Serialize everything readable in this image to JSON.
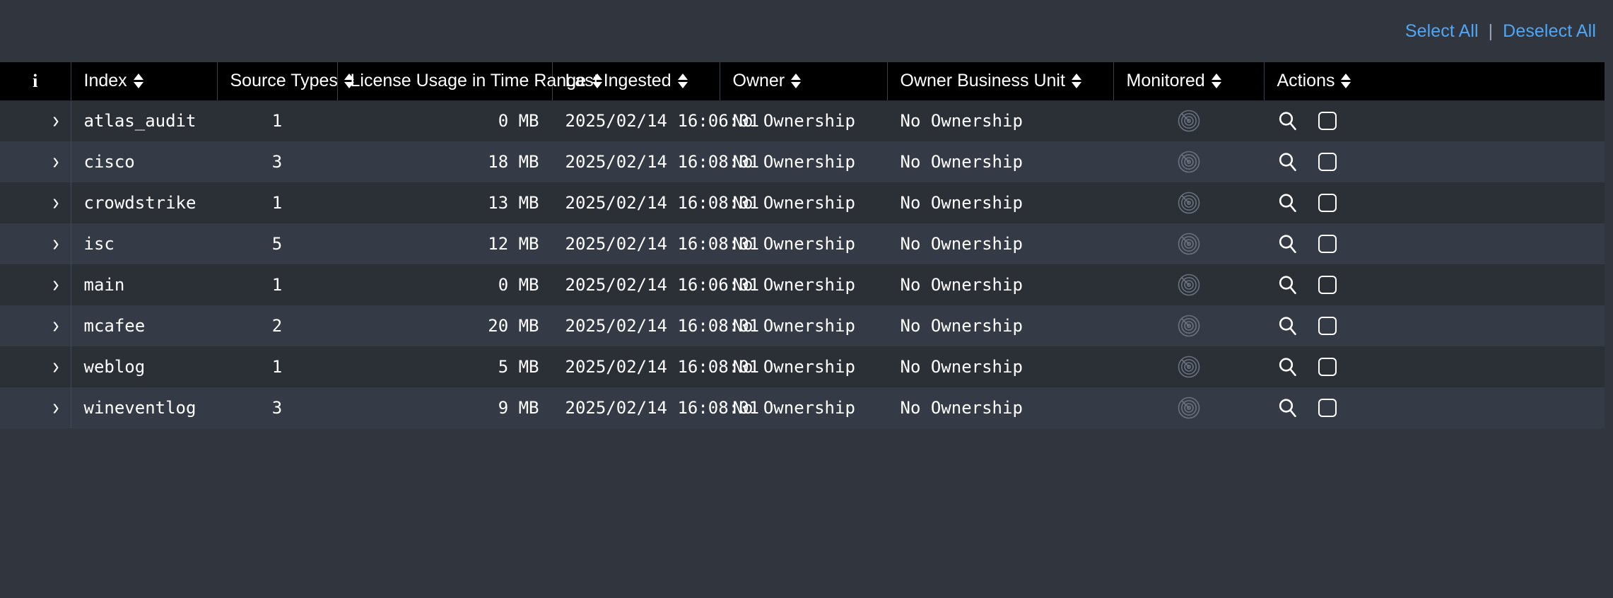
{
  "toolbar": {
    "select_all_label": "Select All",
    "separator": "|",
    "deselect_all_label": "Deselect All",
    "link_color": "#4fa6f5"
  },
  "table": {
    "info_header": "i",
    "columns": [
      {
        "key": "info",
        "label": "i",
        "sortable": false
      },
      {
        "key": "index",
        "label": "Index",
        "sortable": true
      },
      {
        "key": "srctypes",
        "label": "Source Types",
        "sortable": true
      },
      {
        "key": "license",
        "label": "License Usage in Time Range",
        "sortable": true
      },
      {
        "key": "ingested",
        "label": "Last Ingested",
        "sortable": true
      },
      {
        "key": "owner",
        "label": "Owner",
        "sortable": true
      },
      {
        "key": "obu",
        "label": "Owner Business Unit",
        "sortable": true
      },
      {
        "key": "monitored",
        "label": "Monitored",
        "sortable": true
      },
      {
        "key": "actions",
        "label": "Actions",
        "sortable": true
      }
    ],
    "expand_glyph": "›",
    "monitored_icon": "radar-icon",
    "search_icon": "magnifier-icon",
    "select_icon": "checkbox-icon",
    "rows": [
      {
        "index": "atlas_audit",
        "source_types": "1",
        "license_usage": "0 MB",
        "last_ingested": "2025/02/14 16:06:01",
        "owner": "No Ownership",
        "owner_business_unit": "No Ownership"
      },
      {
        "index": "cisco",
        "source_types": "3",
        "license_usage": "18 MB",
        "last_ingested": "2025/02/14 16:08:01",
        "owner": "No Ownership",
        "owner_business_unit": "No Ownership"
      },
      {
        "index": "crowdstrike",
        "source_types": "1",
        "license_usage": "13 MB",
        "last_ingested": "2025/02/14 16:08:01",
        "owner": "No Ownership",
        "owner_business_unit": "No Ownership"
      },
      {
        "index": "isc",
        "source_types": "5",
        "license_usage": "12 MB",
        "last_ingested": "2025/02/14 16:08:01",
        "owner": "No Ownership",
        "owner_business_unit": "No Ownership"
      },
      {
        "index": "main",
        "source_types": "1",
        "license_usage": "0 MB",
        "last_ingested": "2025/02/14 16:06:01",
        "owner": "No Ownership",
        "owner_business_unit": "No Ownership"
      },
      {
        "index": "mcafee",
        "source_types": "2",
        "license_usage": "20 MB",
        "last_ingested": "2025/02/14 16:08:01",
        "owner": "No Ownership",
        "owner_business_unit": "No Ownership"
      },
      {
        "index": "weblog",
        "source_types": "1",
        "license_usage": "5 MB",
        "last_ingested": "2025/02/14 16:08:01",
        "owner": "No Ownership",
        "owner_business_unit": "No Ownership"
      },
      {
        "index": "wineventlog",
        "source_types": "3",
        "license_usage": "9 MB",
        "last_ingested": "2025/02/14 16:08:01",
        "owner": "No Ownership",
        "owner_business_unit": "No Ownership"
      }
    ]
  },
  "colors": {
    "page_background": "#31353e",
    "header_background": "#000000",
    "row_odd": "#2b2f36",
    "row_even": "#343a46",
    "text": "#ffffff",
    "link": "#4fa6f5",
    "muted_icon": "#6d7582"
  }
}
